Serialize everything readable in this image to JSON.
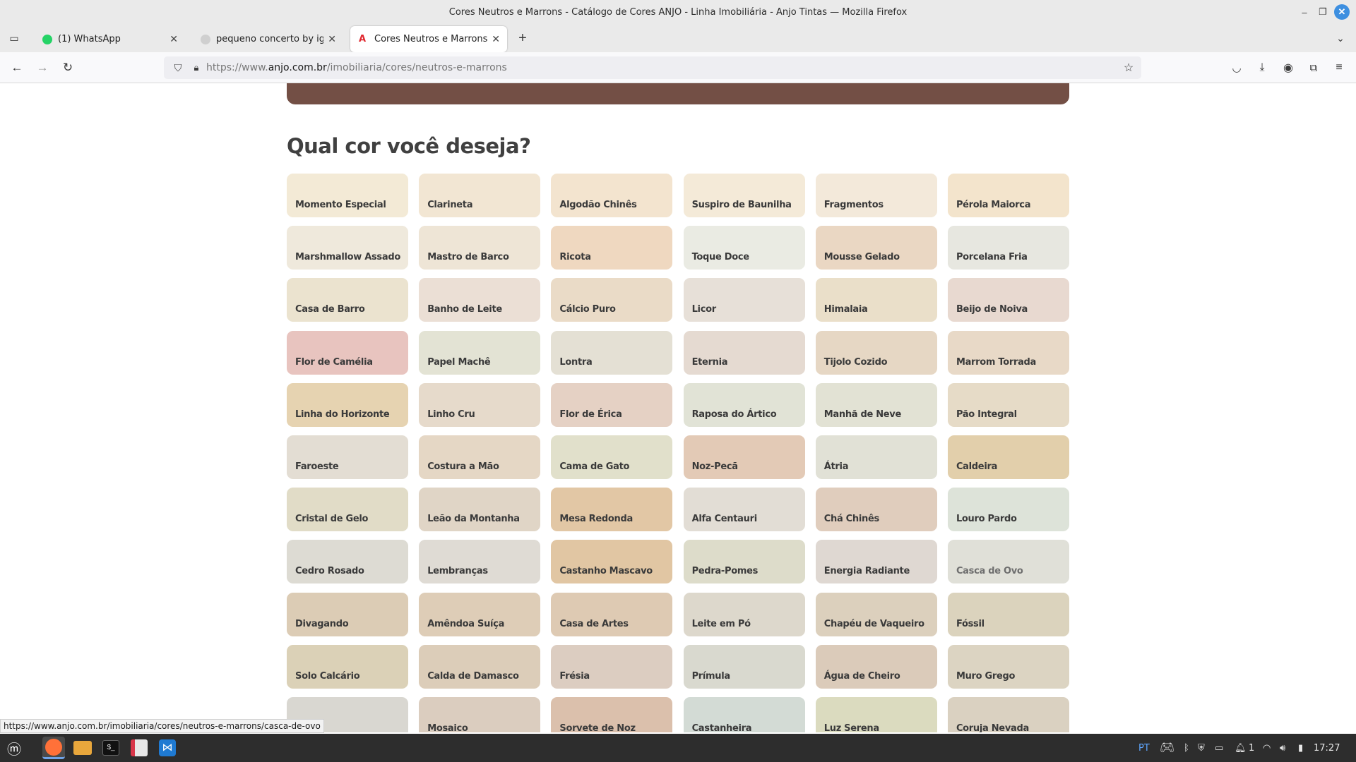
{
  "window": {
    "title": "Cores Neutros e Marrons - Catálogo de Cores ANJO - Linha Imobiliária - Anjo Tintas — Mozilla Firefox"
  },
  "tabs": [
    {
      "label": "(1) WhatsApp",
      "icon": "whatsapp-icon"
    },
    {
      "label": "pequeno concerto by igorb",
      "icon": "github-icon"
    },
    {
      "label": "Cores Neutros e Marrons - C",
      "icon": "anjo-icon",
      "active": true
    }
  ],
  "urlbar": {
    "url_prefix": "https://www.",
    "url_domain": "anjo.com.br",
    "url_path": "/imobiliaria/cores/neutros-e-marrons"
  },
  "page": {
    "heading": "Qual cor você deseja?",
    "banner_color": "#734f45",
    "swatches": [
      {
        "name": "Momento Especial",
        "color": "#f3ead6"
      },
      {
        "name": "Clarineta",
        "color": "#f2e6d3"
      },
      {
        "name": "Algodão Chinês",
        "color": "#f3e4cf"
      },
      {
        "name": "Suspiro de Baunilha",
        "color": "#f4ead8"
      },
      {
        "name": "Fragmentos",
        "color": "#f3e9da"
      },
      {
        "name": "Pérola Maiorca",
        "color": "#f3e4cc"
      },
      {
        "name": "Marshmallow Assado",
        "color": "#efe9dc"
      },
      {
        "name": "Mastro de Barco",
        "color": "#eee5d6"
      },
      {
        "name": "Ricota",
        "color": "#efd8c0"
      },
      {
        "name": "Toque Doce",
        "color": "#eaebe3"
      },
      {
        "name": "Mousse Gelado",
        "color": "#ead7c3"
      },
      {
        "name": "Porcelana Fria",
        "color": "#e7e7e0"
      },
      {
        "name": "Casa de Barro",
        "color": "#ebe3cf"
      },
      {
        "name": "Banho de Leite",
        "color": "#ebdfd5"
      },
      {
        "name": "Cálcio Puro",
        "color": "#eadbc7"
      },
      {
        "name": "Licor",
        "color": "#e7e0d8"
      },
      {
        "name": "Himalaia",
        "color": "#eadfc9"
      },
      {
        "name": "Beijo de Noiva",
        "color": "#e8d9d0"
      },
      {
        "name": "Flor de Camélia",
        "color": "#e8c4bf"
      },
      {
        "name": "Papel Machê",
        "color": "#e3e3d4"
      },
      {
        "name": "Lontra",
        "color": "#e4e0d4"
      },
      {
        "name": "Eternia",
        "color": "#e5dad1"
      },
      {
        "name": "Tijolo Cozido",
        "color": "#e6d7c4"
      },
      {
        "name": "Marrom Torrada",
        "color": "#e8d9c7"
      },
      {
        "name": "Linha do Horizonte",
        "color": "#e6d3b1"
      },
      {
        "name": "Linho Cru",
        "color": "#e6dacb"
      },
      {
        "name": "Flor de Érica",
        "color": "#e5d1c4"
      },
      {
        "name": "Raposa do Ártico",
        "color": "#e1e3d6"
      },
      {
        "name": "Manhã de Neve",
        "color": "#e2e2d4"
      },
      {
        "name": "Pão Integral",
        "color": "#e6dbc7"
      },
      {
        "name": "Faroeste",
        "color": "#e3ddd3"
      },
      {
        "name": "Costura a Mão",
        "color": "#e5d7c5"
      },
      {
        "name": "Cama de Gato",
        "color": "#e1e0cb"
      },
      {
        "name": "Noz-Pecã",
        "color": "#e3cab6"
      },
      {
        "name": "Átria",
        "color": "#e1e1d6"
      },
      {
        "name": "Caldeira",
        "color": "#e2cfab"
      },
      {
        "name": "Cristal de Gelo",
        "color": "#e1dcc7"
      },
      {
        "name": "Leão da Montanha",
        "color": "#e0d5c6"
      },
      {
        "name": "Mesa Redonda",
        "color": "#e2c7a5"
      },
      {
        "name": "Alfa Centauri",
        "color": "#e2ddd5"
      },
      {
        "name": "Chá Chinês",
        "color": "#e0cdbd"
      },
      {
        "name": "Louro Pardo",
        "color": "#dde3d9"
      },
      {
        "name": "Cedro Rosado",
        "color": "#dddbd3"
      },
      {
        "name": "Lembranças",
        "color": "#dfdbd4"
      },
      {
        "name": "Castanho Mascavo",
        "color": "#e1c6a3"
      },
      {
        "name": "Pedra-Pomes",
        "color": "#dddcca"
      },
      {
        "name": "Energia Radiante",
        "color": "#dfd8d2"
      },
      {
        "name": "Casca de Ovo",
        "color": "#e0e0d8"
      },
      {
        "name": "Divagando",
        "color": "#dcccb5"
      },
      {
        "name": "Amêndoa Suíça",
        "color": "#decdb7"
      },
      {
        "name": "Casa de Artes",
        "color": "#decab3"
      },
      {
        "name": "Leite em Pó",
        "color": "#ddd8cc"
      },
      {
        "name": "Chapéu de Vaqueiro",
        "color": "#dcd0bd"
      },
      {
        "name": "Fóssil",
        "color": "#dbd3bd"
      },
      {
        "name": "Solo Calcário",
        "color": "#dbd1b7"
      },
      {
        "name": "Calda de Damasco",
        "color": "#dccdb9"
      },
      {
        "name": "Frésia",
        "color": "#dccdc1"
      },
      {
        "name": "Prímula",
        "color": "#d9d9cf"
      },
      {
        "name": "Água de Cheiro",
        "color": "#dbcbba"
      },
      {
        "name": "Muro Grego",
        "color": "#dcd4c2"
      },
      {
        "name": "",
        "color": "#d9d7d1"
      },
      {
        "name": "Mosaico",
        "color": "#dbcdbf"
      },
      {
        "name": "Sorvete de Noz",
        "color": "#dbc0ac"
      },
      {
        "name": "Castanheira",
        "color": "#d3dbd5"
      },
      {
        "name": "Luz Serena",
        "color": "#dbdbbf"
      },
      {
        "name": "Coruja Nevada",
        "color": "#dad1c1"
      }
    ]
  },
  "status_url": "https://www.anjo.com.br/imobiliaria/cores/neutros-e-marrons/casca-de-ovo",
  "taskbar": {
    "language": "PT",
    "notification_count": "1",
    "clock": "17:27"
  }
}
